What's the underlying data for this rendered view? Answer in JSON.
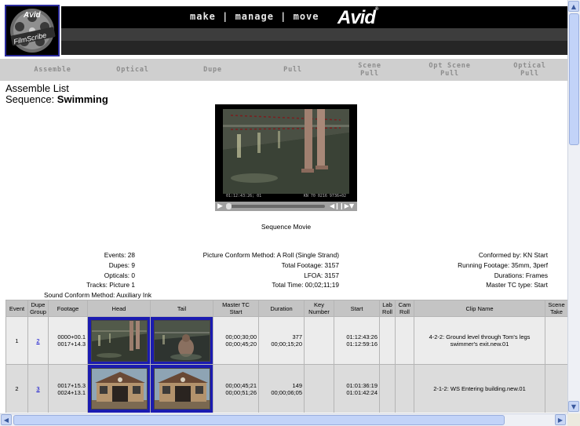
{
  "header": {
    "logo_top_text": "Avid",
    "logo_badge_text": "FilmScribe",
    "tagline": "make | manage | move",
    "brand": "Avid",
    "brand_mark": "®",
    "colors": {
      "header_bg": "#000000",
      "nav_bg": "#cfcfcf",
      "nav_text": "#8c8c8c",
      "thumb_border": "#1b1bb0",
      "link": "#0000cc"
    }
  },
  "nav": {
    "items": [
      {
        "label": "Assemble"
      },
      {
        "label": "Optical"
      },
      {
        "label": "Dupe"
      },
      {
        "label": "Pull"
      },
      {
        "label": "Scene\nPull"
      },
      {
        "label": "Opt Scene\nPull"
      },
      {
        "label": "Optical\nPull"
      }
    ]
  },
  "page": {
    "title": "Assemble List",
    "sequence_label": "Sequence:",
    "sequence_name": "Swimming"
  },
  "movie": {
    "timecode_left": "01:12:43:26; 01",
    "timecode_right": "KN 70 0216 9736+02",
    "caption": "Sequence Movie"
  },
  "stats": {
    "events": "Events: 28",
    "dupes": "Dupes: 9",
    "opticals": "Opticals: 0",
    "tracks": "Tracks: Picture 1",
    "sound_conform": "Sound Conform Method: Auxiliary Ink",
    "picture_conform": "Picture Conform Method: A Roll (Single Strand)",
    "total_footage": "Total Footage: 3157",
    "lfoa": "LFOA: 3157",
    "total_time": "Total Time: 00;02;11;19",
    "conformed_by": "Conformed by: KN Start",
    "running_footage": "Running Footage: 35mm, 3perf",
    "durations": "Durations: Frames",
    "master_tc_type": "Master TC type: Start"
  },
  "table": {
    "headers": {
      "event": "Event",
      "dupe_group": "Dupe\nGroup",
      "footage": "Footage",
      "head": "Head",
      "tail": "Tail",
      "master_tc": "Master TC\nStart",
      "duration": "Duration",
      "key_number": "Key\nNumber",
      "start": "Start",
      "lab_roll": "Lab\nRoll",
      "cam_roll": "Cam\nRoll",
      "clip_name": "Clip Name",
      "scene_take": "Scene\nTake"
    },
    "rows": [
      {
        "event": "1",
        "dupe_group": "2",
        "footage": "0000+00.1\n0017+14.3",
        "master_tc": "00;00;30;00\n00;00;45;20",
        "duration": "377\n00;00;15;20",
        "key_number": "",
        "start": "01:12:43:26\n01:12:59:16",
        "lab_roll": "",
        "cam_roll": "",
        "clip_name": "4-2-2: Ground level through Tom's legs swimmer's exit.new.01",
        "scene_take": "",
        "head_icon": "pool-frame",
        "tail_icon": "pool-frame"
      },
      {
        "event": "2",
        "dupe_group": "3",
        "footage": "0017+15.3\n0024+13.1",
        "master_tc": "00;00;45;21\n00;00;51;26",
        "duration": "149\n00;00;06;05",
        "key_number": "",
        "start": "01:01:36:19\n01:01:42:24",
        "lab_roll": "",
        "cam_roll": "",
        "clip_name": "2-1-2: WS Entering building.new.01",
        "scene_take": "",
        "head_icon": "building-frame",
        "tail_icon": "building-frame"
      }
    ]
  }
}
